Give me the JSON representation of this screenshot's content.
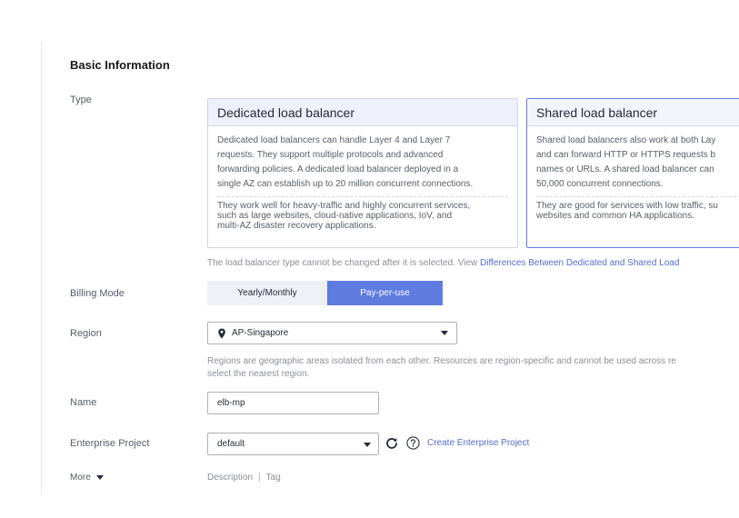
{
  "section": {
    "title": "Basic Information"
  },
  "type": {
    "label": "Type",
    "dedicated": {
      "title": "Dedicated load balancer",
      "desc_lines": [
        "Dedicated load balancers can handle Layer 4 and Layer 7",
        "requests. They support multiple protocols and advanced",
        "forwarding policies. A dedicated load balancer deployed in a",
        "single AZ can establish up to 20 million concurrent connections."
      ],
      "use_lines": [
        "They work well for heavy-traffic and highly concurrent services,",
        "such as large websites, cloud-native applications, IoV, and",
        "multi-AZ disaster recovery applications."
      ]
    },
    "shared": {
      "title": "Shared load balancer",
      "desc_lines": [
        "Shared load balancers also work at both Lay",
        "and can forward HTTP or HTTPS requests b",
        "names or URLs. A shared load balancer can",
        "50,000 concurrent connections."
      ],
      "use_lines": [
        "They are good for services with low traffic, su",
        "websites and common HA applications."
      ]
    },
    "hint": "The load balancer type cannot be changed after it is selected. View ",
    "hint_link": "Differences Between Dedicated and Shared Load"
  },
  "billing": {
    "label": "Billing Mode",
    "options": [
      "Yearly/Monthly",
      "Pay-per-use"
    ],
    "selected": "Pay-per-use"
  },
  "region": {
    "label": "Region",
    "value": "AP-Singapore",
    "hint_lines": [
      "Regions are geographic areas isolated from each other. Resources are region-specific and cannot be used across re",
      "select the nearest region."
    ]
  },
  "name": {
    "label": "Name",
    "value": "elb-mp"
  },
  "enterprise_project": {
    "label": "Enterprise Project",
    "value": "default",
    "create_link": "Create Enterprise Project"
  },
  "more": {
    "label": "More",
    "description": "Description",
    "separator": "|",
    "tag": "Tag"
  },
  "colors": {
    "accent": "#5e7ce0",
    "link": "#526ecc"
  },
  "icons": [
    "location-pin-icon",
    "chevron-down-icon",
    "refresh-icon",
    "help-icon"
  ]
}
